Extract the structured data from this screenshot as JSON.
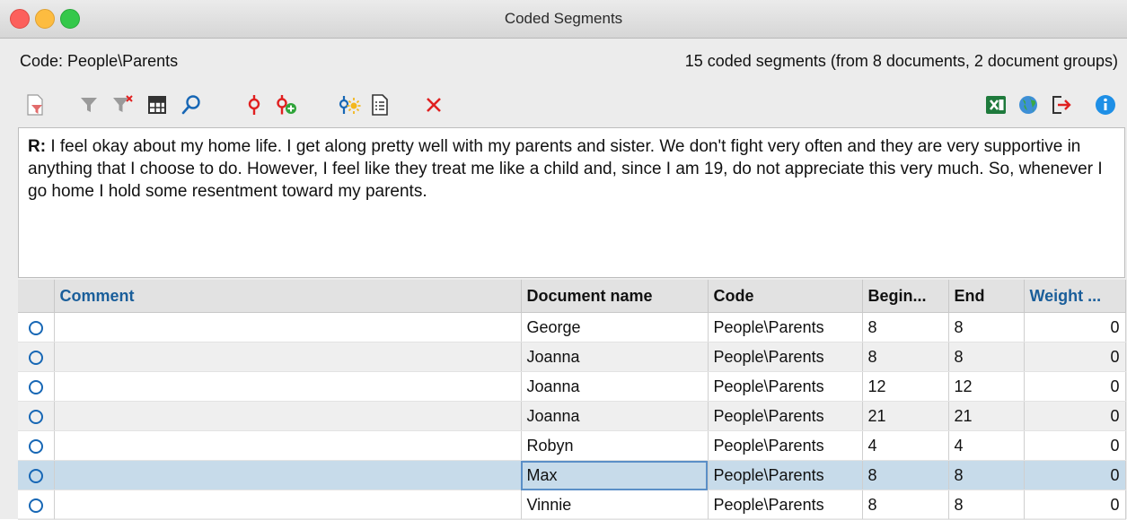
{
  "window": {
    "title": "Coded Segments"
  },
  "header": {
    "code_label": "Code: People\\Parents",
    "segment_summary": "15 coded segments (from 8 documents, 2 document groups)"
  },
  "toolbar": {
    "left_icons": [
      "document-filter-icon",
      "filter-icon",
      "clear-filter-icon",
      "table-view-icon",
      "search-icon",
      "code-pin-icon",
      "add-code-icon",
      "autocode-icon",
      "overview-icon",
      "delete-icon"
    ],
    "right_icons": [
      "excel-export-icon",
      "globe-icon",
      "export-icon",
      "info-icon"
    ]
  },
  "preview": {
    "speaker": "R:",
    "text": " I feel okay about my home life. I get along pretty well with my parents and sister. We don't fight very often and they are very supportive in anything that I choose to do. However, I feel like they treat me like a child and, since I am 19, do not appreciate this very much. So, whenever I go home I hold some resentment toward my parents."
  },
  "table": {
    "columns": [
      "",
      "Comment",
      "Document name",
      "Code",
      "Begin...",
      "End",
      "Weight ..."
    ],
    "rows": [
      {
        "comment": "",
        "document": "George",
        "code": "People\\Parents",
        "begin": "8",
        "end": "8",
        "weight": "0"
      },
      {
        "comment": "",
        "document": "Joanna",
        "code": "People\\Parents",
        "begin": "8",
        "end": "8",
        "weight": "0"
      },
      {
        "comment": "",
        "document": "Joanna",
        "code": "People\\Parents",
        "begin": "12",
        "end": "12",
        "weight": "0"
      },
      {
        "comment": "",
        "document": "Joanna",
        "code": "People\\Parents",
        "begin": "21",
        "end": "21",
        "weight": "0"
      },
      {
        "comment": "",
        "document": "Robyn",
        "code": "People\\Parents",
        "begin": "4",
        "end": "4",
        "weight": "0"
      },
      {
        "comment": "",
        "document": "Max",
        "code": "People\\Parents",
        "begin": "8",
        "end": "8",
        "weight": "0"
      },
      {
        "comment": "",
        "document": "Vinnie",
        "code": "People\\Parents",
        "begin": "8",
        "end": "8",
        "weight": "0"
      }
    ]
  },
  "colors": {
    "accent_blue": "#1767b5",
    "selected_row": "#c7dbea",
    "code_red": "#e02020",
    "excel_green": "#1e7a3c"
  }
}
